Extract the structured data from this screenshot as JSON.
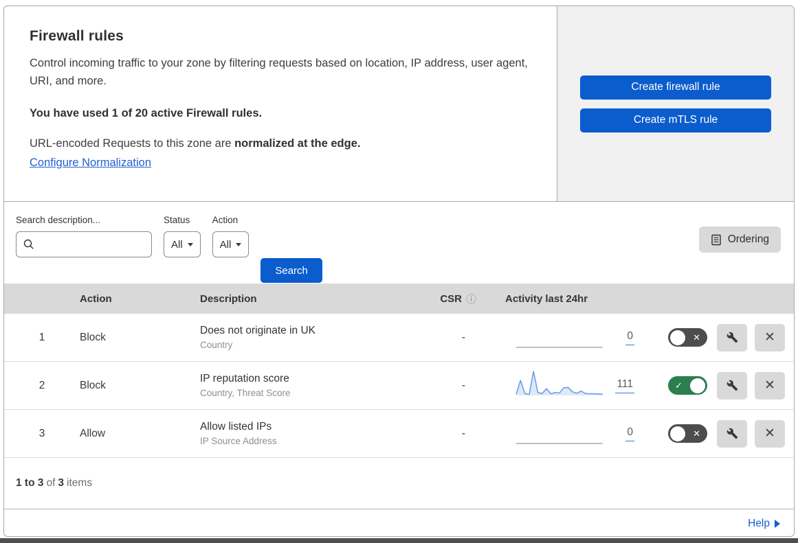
{
  "header": {
    "title": "Firewall rules",
    "description": "Control incoming traffic to your zone by filtering requests based on location, IP address, user agent, URI, and more.",
    "usage_bold": "You have used 1 of 20 active Firewall rules.",
    "normalization_text": "URL-encoded Requests to this zone are ",
    "normalization_bold": "normalized at the edge.",
    "normalization_link": "Configure Normalization",
    "create_firewall_button": "Create firewall rule",
    "create_mtls_button": "Create mTLS rule"
  },
  "filters": {
    "search_label": "Search description...",
    "status_label": "Status",
    "status_value": "All",
    "action_label": "Action",
    "action_value": "All",
    "search_button": "Search",
    "ordering_button": "Ordering"
  },
  "table": {
    "columns": {
      "action": "Action",
      "description": "Description",
      "csr": "CSR",
      "activity": "Activity last 24hr"
    },
    "rows": [
      {
        "priority": "1",
        "action": "Block",
        "description": "Does not originate in UK",
        "fields": "Country",
        "csr": "-",
        "activity_count": "0",
        "enabled": false,
        "sparkline": []
      },
      {
        "priority": "2",
        "action": "Block",
        "description": "IP reputation score",
        "fields": "Country, Threat Score",
        "csr": "-",
        "activity_count": "111",
        "enabled": true,
        "sparkline": [
          5,
          62,
          8,
          4,
          100,
          12,
          8,
          28,
          7,
          12,
          10,
          32,
          33,
          15,
          9,
          18,
          8,
          7,
          7,
          6,
          5
        ]
      },
      {
        "priority": "3",
        "action": "Allow",
        "description": "Allow listed IPs",
        "fields": "IP Source Address",
        "csr": "-",
        "activity_count": "0",
        "enabled": false,
        "sparkline": []
      }
    ]
  },
  "footer": {
    "range_bold": "1 to 3",
    "of_text": "of",
    "total_bold": "3",
    "items_text": "items",
    "help_label": "Help"
  },
  "icons": {
    "toggle_check": "✓",
    "toggle_x": "✕",
    "close_x": "✕",
    "info": "ⓘ"
  },
  "colors": {
    "accent_blue": "#0b5ccd",
    "link_blue": "#2160d0",
    "toggle_on_green": "#2b7e4e",
    "toggle_off_gray": "#4d4d4d",
    "sparkline_line": "#6f9ee8",
    "sparkline_fill": "#dde9fa",
    "flat_line_gray": "#9a9a9a"
  }
}
